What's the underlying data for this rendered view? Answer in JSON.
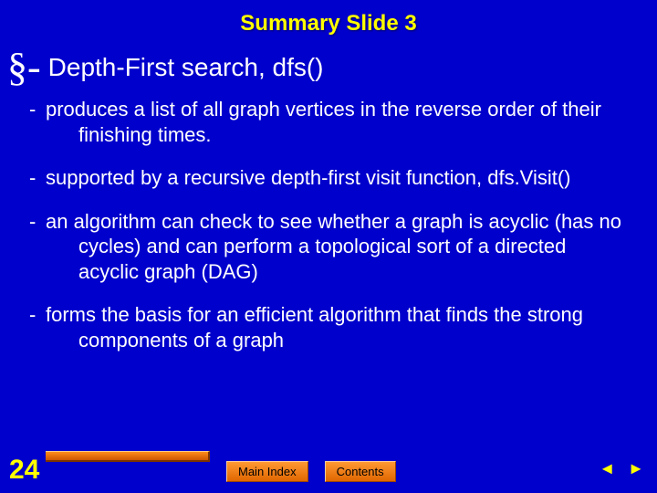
{
  "title": "Summary Slide 3",
  "section_marker": "§-",
  "section_heading": "Depth-First search, dfs()",
  "bullets": [
    "produces a list of all graph vertices in the reverse order of their finishing times.",
    "supported by a recursive depth-first visit function, dfs.Visit()",
    "an algorithm can check to see whether a graph is acyclic (has no cycles) and can perform a topological sort of a directed acyclic graph (DAG)",
    "forms the basis for an efficient algorithm that finds the strong components of a graph"
  ],
  "page_number": "24",
  "nav": {
    "main_index": "Main Index",
    "contents": "Contents"
  },
  "arrows": {
    "prev": "◄",
    "next": "►"
  },
  "dash": "-"
}
